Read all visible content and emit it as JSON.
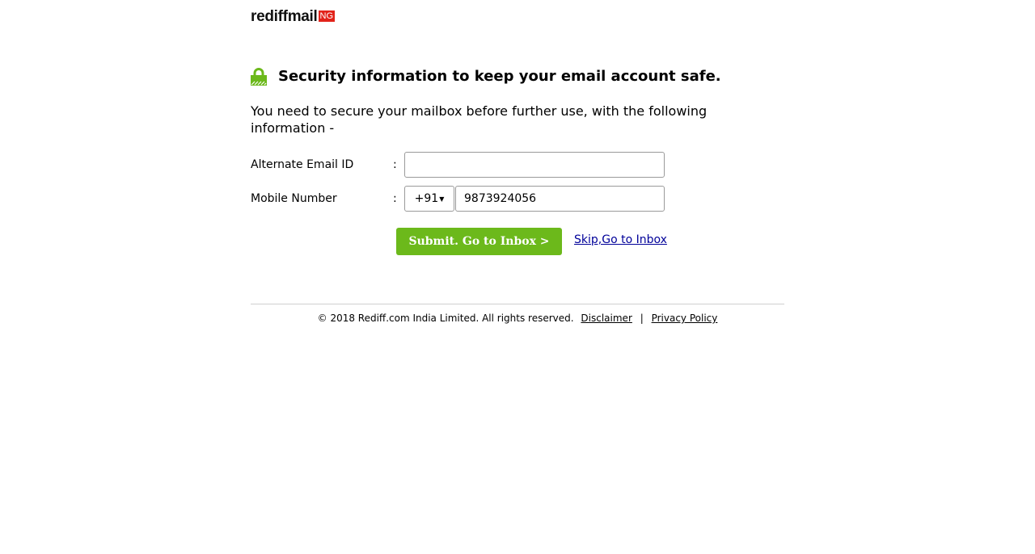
{
  "logo": {
    "text": "rediffmail",
    "badge": "NG",
    "badge_color": "#e2231a"
  },
  "heading": {
    "icon": "lock-icon",
    "icon_color": "#6cb91b",
    "text": "Security information to keep your email account safe."
  },
  "intro": "You need to secure your mailbox before further use, with the following information -",
  "form": {
    "email": {
      "label": "Alternate Email ID",
      "colon": ":",
      "value": "",
      "placeholder": ""
    },
    "mobile": {
      "label": "Mobile Number",
      "colon": ":",
      "country_code": "+91",
      "value": "9873924056"
    }
  },
  "actions": {
    "submit_label": "Submit. Go to Inbox >",
    "submit_color": "#6cb91b",
    "skip_label": "Skip,Go to Inbox"
  },
  "footer": {
    "copyright": "© 2018 Rediff.com India Limited. All rights reserved.",
    "disclaimer": "Disclaimer",
    "separator": "|",
    "privacy": "Privacy Policy"
  }
}
